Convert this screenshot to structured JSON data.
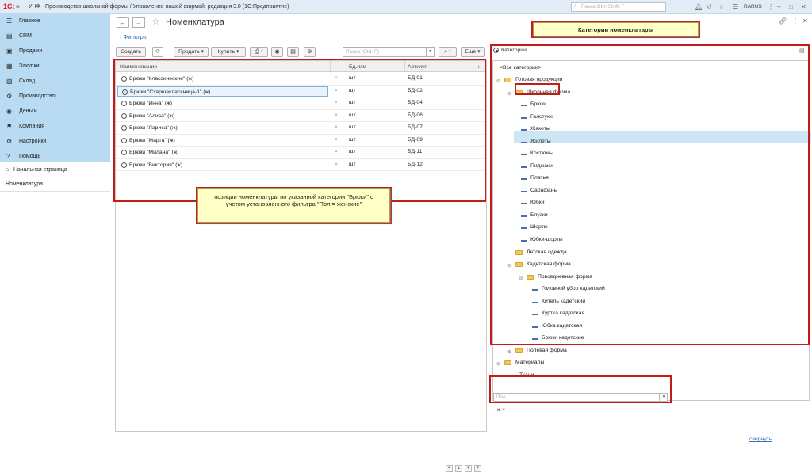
{
  "titlebar": {
    "logo": "1С:",
    "app_title": "УНФ - Производство школьной формы / Управление нашей фирмой, редакция 3.0  (1С:Предприятие)",
    "search_placeholder": "Поиск Ctrl+Shift+F",
    "user": "RARUS"
  },
  "sections": [
    {
      "label": "Главное",
      "icon": "home-icon"
    },
    {
      "label": "CRM",
      "icon": "crm-icon"
    },
    {
      "label": "Продажи",
      "icon": "sales-icon"
    },
    {
      "label": "Закупки",
      "icon": "purchases-icon"
    },
    {
      "label": "Склад",
      "icon": "warehouse-icon"
    },
    {
      "label": "Производство",
      "icon": "production-icon"
    },
    {
      "label": "Деньги",
      "icon": "money-icon"
    },
    {
      "label": "Компания",
      "icon": "flag-icon"
    },
    {
      "label": "Настройки",
      "icon": "gear-icon"
    },
    {
      "label": "Помощь",
      "icon": "help-icon"
    }
  ],
  "open_pages": [
    {
      "label": "Начальная страница"
    },
    {
      "label": "Номенклатура"
    }
  ],
  "page": {
    "title": "Номенклатура",
    "filters_link": "Фильтры"
  },
  "toolbar": {
    "create": "Создать",
    "sell": "Продать",
    "buy": "Купить",
    "search_placeholder": "Поиск (Ctrl+F)",
    "more": "Еще"
  },
  "grid": {
    "headers": {
      "name": "Наименование",
      "unit": "Ед.изм",
      "article": "Артикул"
    },
    "rows": [
      {
        "name": "Брюки \"Классические\" (ж)",
        "unit": "шт",
        "article": "БД-01"
      },
      {
        "name": "Брюки \"Старшеклассница-1\" (ж)",
        "unit": "шт",
        "article": "БД-02"
      },
      {
        "name": "Брюки \"Инна\" (ж)",
        "unit": "шт",
        "article": "БД-04"
      },
      {
        "name": "Брюки \"Алиса\" (ж)",
        "unit": "шт",
        "article": "БД-06"
      },
      {
        "name": "Брюки \"Лариса\" (ж)",
        "unit": "шт",
        "article": "БД-07"
      },
      {
        "name": "Брюки \"Марта\" (ж)",
        "unit": "шт",
        "article": "БД-09"
      },
      {
        "name": "Брюки \"Милана\" (ж)",
        "unit": "шт",
        "article": "БД-11"
      },
      {
        "name": "Брюки \"Виктория\" (ж)",
        "unit": "шт",
        "article": "БД-12"
      }
    ]
  },
  "notes": {
    "positions": "позиции номенклатуры по указанной категории \"Брюки\" с учетом установленного фильтра \"Пол = женские\"",
    "categories": "Категории номенклатары"
  },
  "categories_panel": {
    "radio_label": "Категории",
    "tree": [
      {
        "label": "<Все категории>",
        "type": "root"
      },
      {
        "label": "Готовая продукция",
        "type": "folder",
        "expander": "⊖"
      },
      {
        "label": "Школьная форма",
        "type": "folder",
        "expander": "⊖"
      },
      {
        "label": "Брюки",
        "type": "item",
        "selected": true
      },
      {
        "label": "Галстуки",
        "type": "item"
      },
      {
        "label": "Жакеты",
        "type": "item"
      },
      {
        "label": "Жилеты",
        "type": "item"
      },
      {
        "label": "Костюмы",
        "type": "item"
      },
      {
        "label": "Пиджаки",
        "type": "item"
      },
      {
        "label": "Платья",
        "type": "item"
      },
      {
        "label": "Сарафаны",
        "type": "item"
      },
      {
        "label": "Юбки",
        "type": "item"
      },
      {
        "label": "Блузки",
        "type": "item"
      },
      {
        "label": "Шорты",
        "type": "item"
      },
      {
        "label": "Юбки-шорты",
        "type": "item"
      },
      {
        "label": "Детская одежда",
        "type": "folder"
      },
      {
        "label": "Кадетская форма",
        "type": "folder",
        "expander": "⊖"
      },
      {
        "label": "Повседневная форма",
        "type": "folder",
        "expander": "⊖"
      },
      {
        "label": "Головной убор кадетский",
        "type": "item"
      },
      {
        "label": "Китель кадетский",
        "type": "item"
      },
      {
        "label": "Куртка кадетская",
        "type": "item"
      },
      {
        "label": "Юбка кадетская",
        "type": "item"
      },
      {
        "label": "Брюки кадетские",
        "type": "item"
      },
      {
        "label": "Полевая форма",
        "type": "folder",
        "expander": "⊕"
      },
      {
        "label": "Материалы",
        "type": "folder",
        "expander": "⊖"
      },
      {
        "label": "Ткани",
        "type": "item"
      }
    ],
    "filter_placeholder": "Пол",
    "filter_tag": "ж ×",
    "collapse_link": "свернуть"
  }
}
